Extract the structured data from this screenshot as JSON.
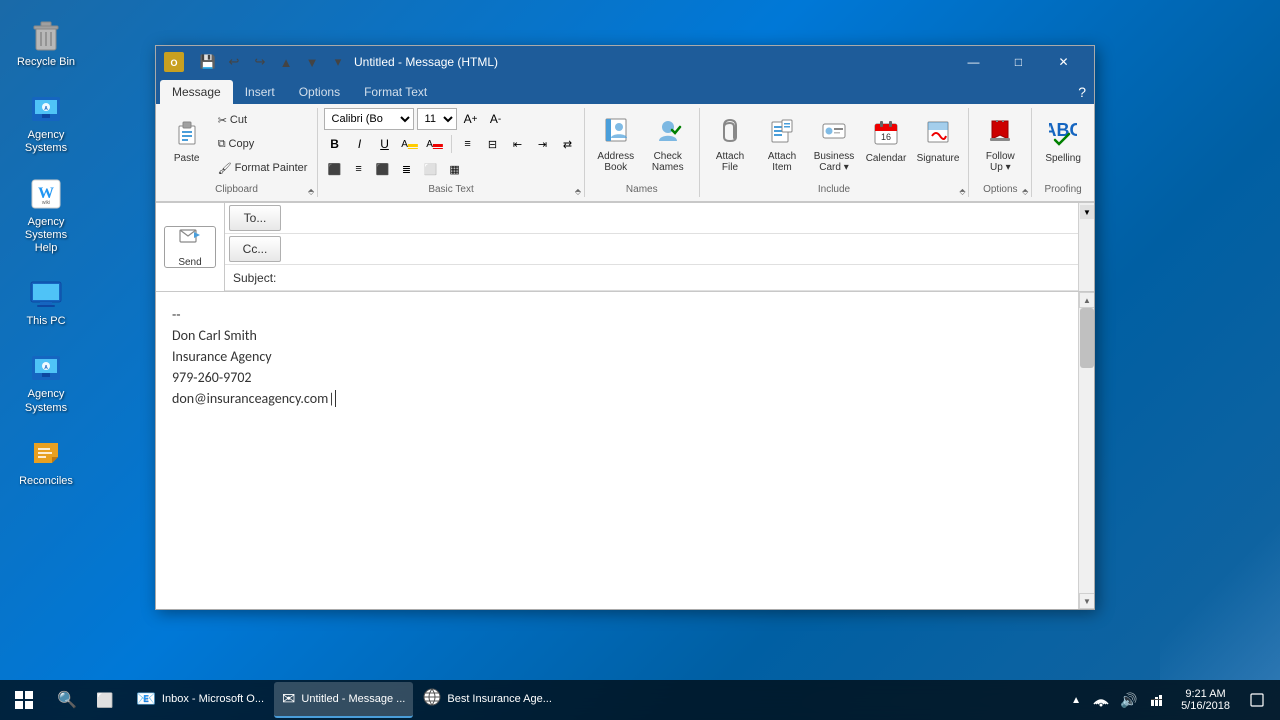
{
  "desktop": {
    "icons": [
      {
        "id": "recycle-bin",
        "label": "Recycle Bin",
        "icon": "🗑️"
      },
      {
        "id": "agency-systems",
        "label": "Agency\nSystems",
        "icon": "🏢"
      },
      {
        "id": "agency-systems-help",
        "label": "Agency\nSystems Help",
        "icon": "📖"
      },
      {
        "id": "this-pc",
        "label": "This PC",
        "icon": "💻"
      },
      {
        "id": "agency-systems-2",
        "label": "Agency\nSystems",
        "icon": "🏢"
      },
      {
        "id": "reconciles",
        "label": "Reconciles",
        "icon": "📁"
      }
    ]
  },
  "window": {
    "title": "Untitled - Message (HTML)",
    "icon": "✉"
  },
  "title_bar": {
    "minimize": "—",
    "maximize": "□",
    "close": "✕",
    "help": "?"
  },
  "quick_access": {
    "save": "💾",
    "undo": "↩",
    "redo": "↪",
    "up": "▲",
    "down": "▼",
    "dropdown": "▾"
  },
  "ribbon": {
    "tabs": [
      "Message",
      "Insert",
      "Options",
      "Format Text"
    ],
    "active_tab": "Message",
    "groups": {
      "clipboard": {
        "label": "Clipboard",
        "paste_label": "Paste",
        "cut_label": "Cut",
        "copy_label": "Copy",
        "format_painter_label": "Format Painter"
      },
      "basic_text": {
        "label": "Basic Text",
        "font_name": "Calibri (Bo",
        "font_size": "11",
        "bold": "B",
        "italic": "I",
        "underline": "U",
        "grow": "A↑",
        "shrink": "A↓",
        "bullets": "☰",
        "numbering": "☷",
        "decrease_indent": "⬅",
        "increase_indent": "➡",
        "rtl": "⇄"
      },
      "names": {
        "label": "Names",
        "address_book": "Address\nBook",
        "check_names": "Check\nNames"
      },
      "include": {
        "label": "Include",
        "attach_file": "Attach\nFile",
        "attach_item": "Attach\nItem",
        "business_card": "Business\nCard",
        "calendar": "Calendar",
        "signature": "Signature"
      },
      "options": {
        "label": "Options",
        "follow_up": "Follow\nUp ▾"
      },
      "proofing": {
        "label": "Proofing",
        "spelling": "Spelling"
      }
    }
  },
  "message": {
    "to_label": "To...",
    "cc_label": "Cc...",
    "subject_label": "Subject:",
    "to_value": "",
    "cc_value": "",
    "subject_value": "",
    "send_label": "Send",
    "body": "--\nDon Carl Smith\nInsurance Agency\n979-260-9702\ndon@insuranceagency.com"
  },
  "taskbar": {
    "time": "9:21 AM",
    "date": "5/16/2018",
    "items": [
      {
        "label": "Inbox - Microsoft O...",
        "icon": "📧",
        "active": false
      },
      {
        "label": "Untitled - Message ...",
        "icon": "✉",
        "active": true
      },
      {
        "label": "Best Insurance Age...",
        "icon": "🌐",
        "active": false
      }
    ],
    "tray_icons": [
      "▲",
      "🔊",
      "📶",
      "⚡"
    ]
  }
}
